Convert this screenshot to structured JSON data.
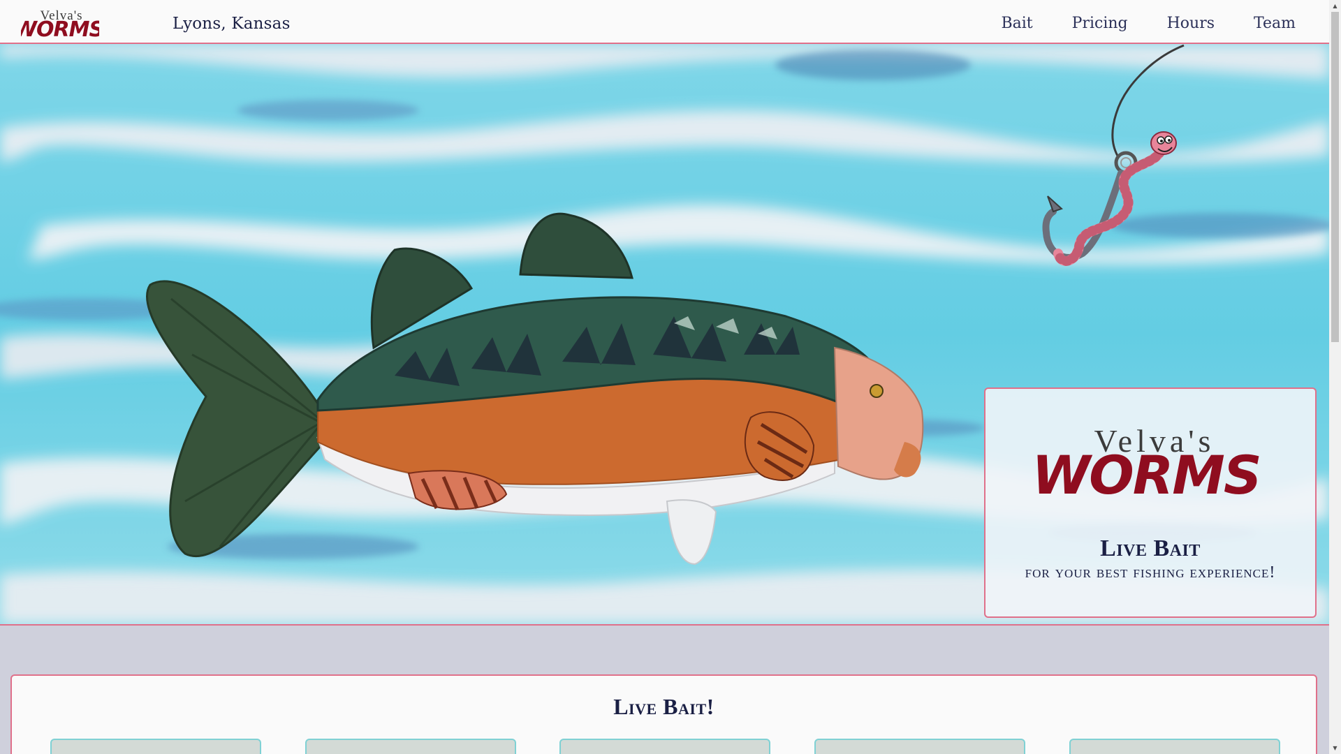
{
  "navbar": {
    "logo_top": "Velva's",
    "logo_bottom": "WORMS",
    "location": "Lyons, Kansas",
    "links": [
      {
        "label": "Bait"
      },
      {
        "label": "Pricing"
      },
      {
        "label": "Hours"
      },
      {
        "label": "Team"
      }
    ]
  },
  "hero": {
    "card": {
      "logo_top": "Velva's",
      "logo_bottom": "WORMS",
      "title": "Live Bait",
      "subtitle": "for your best fishing experience!"
    }
  },
  "bait_section": {
    "heading": "Live Bait!"
  },
  "colors": {
    "accent": "#e0708a",
    "navy": "#1a1f44",
    "worm_red": "#8f0d1f",
    "water_blue": "#5ccbe0",
    "card_teal_border": "#7fd1d4"
  },
  "icons": {
    "hook": "fishing-hook-icon",
    "worm": "worm-icon",
    "fish": "bass-fish-illustration",
    "scroll_up": "arrow-up-icon",
    "scroll_down": "arrow-down-icon"
  }
}
